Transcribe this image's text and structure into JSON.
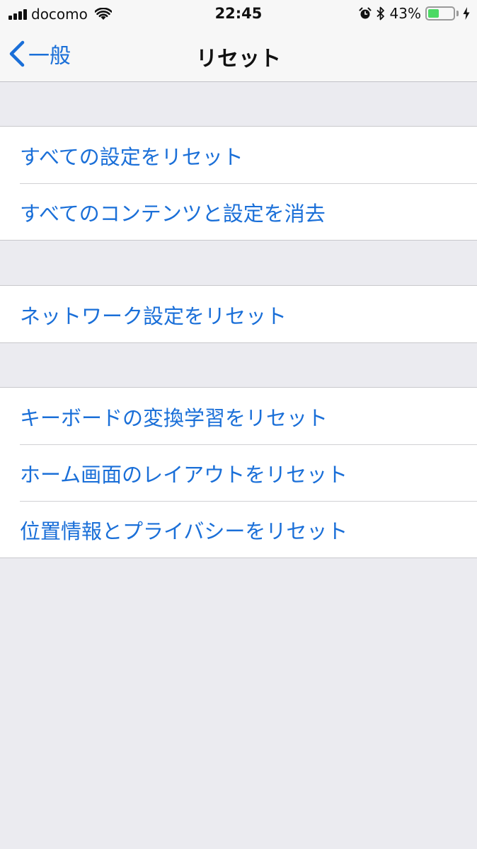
{
  "status_bar": {
    "carrier": "docomo",
    "time": "22:45",
    "battery_percent": "43%",
    "battery_level": 0.43,
    "icons": [
      "signal-icon",
      "wifi-icon",
      "alarm-icon",
      "bluetooth-icon",
      "battery-icon",
      "charging-icon"
    ]
  },
  "nav": {
    "back_label": "一般",
    "title": "リセット"
  },
  "groups": [
    {
      "items": [
        "すべての設定をリセット",
        "すべてのコンテンツと設定を消去"
      ]
    },
    {
      "items": [
        "ネットワーク設定をリセット"
      ]
    },
    {
      "items": [
        "キーボードの変換学習をリセット",
        "ホーム画面のレイアウトをリセット",
        "位置情報とプライバシーをリセット"
      ]
    }
  ],
  "colors": {
    "accent": "#1a6fd8",
    "background": "#ebebf0",
    "cell": "#ffffff",
    "battery_fill": "#4cd964"
  }
}
